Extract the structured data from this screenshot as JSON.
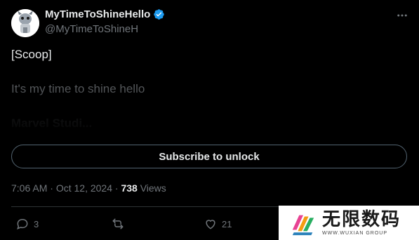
{
  "tweet": {
    "author": {
      "name": "MyTimeToShineHello",
      "handle": "@MyTimeToShineH",
      "verified_color": "#1d9bf0"
    },
    "lines": [
      "[Scoop]",
      "It's my time to shine hello",
      "Marvel Studi..."
    ],
    "subscribe_label": "Subscribe to unlock",
    "meta": {
      "time": "7:06 AM",
      "separator1": " · ",
      "date": "Oct 12, 2024",
      "separator2": " · ",
      "views_count": "738",
      "views_label": " Views"
    },
    "actions": {
      "replies": "3",
      "retweets": "",
      "likes": "21"
    }
  },
  "watermark": {
    "title": "无限数码",
    "subtitle": "WWW.WUXIAN GROUP"
  }
}
